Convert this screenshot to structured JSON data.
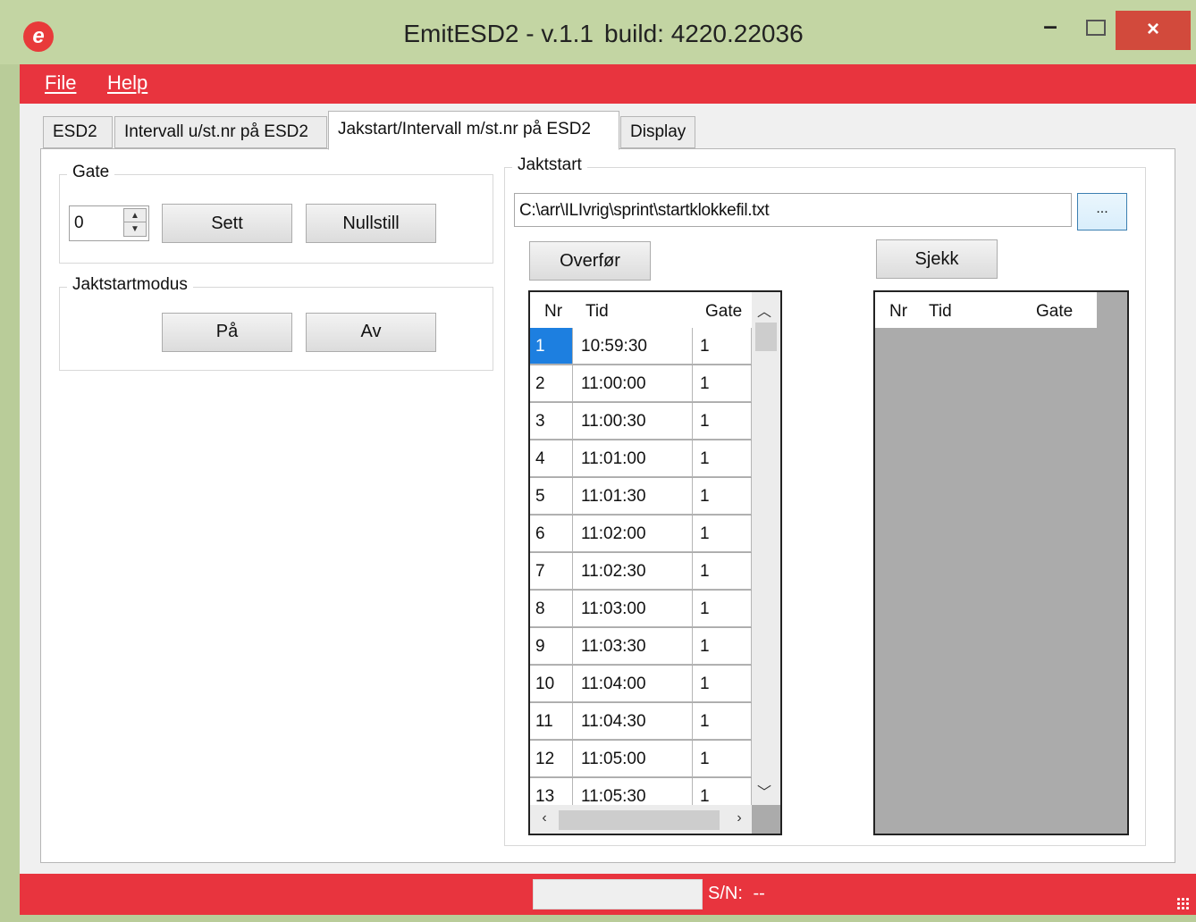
{
  "window": {
    "title": "EmitESD2  - v.1.1",
    "build": "build: 4220.22036",
    "close_glyph": "×",
    "minimize_glyph": "–"
  },
  "menu": {
    "items": [
      "File",
      "Help"
    ]
  },
  "tabs": [
    "ESD2",
    "Intervall u/st.nr på ESD2",
    "Jakstart/Intervall m/st.nr på ESD2",
    "Display"
  ],
  "active_tab": 2,
  "gate_group": {
    "title": "Gate",
    "spinner_value": "0",
    "set_label": "Sett",
    "reset_label": "Nullstill"
  },
  "mode_group": {
    "title": "Jaktstartmodus",
    "on_label": "På",
    "off_label": "Av"
  },
  "jaktstart": {
    "title": "Jaktstart",
    "file_path": "C:\\arr\\ILIvrig\\sprint\\startklokkefil.txt",
    "browse_label": "...",
    "transfer_label": "Overfør",
    "check_label": "Sjekk"
  },
  "left_grid": {
    "columns": [
      "Nr",
      "Tid",
      "Gate"
    ],
    "selected_row": 0,
    "rows": [
      [
        "1",
        "10:59:30",
        "1"
      ],
      [
        "2",
        "11:00:00",
        "1"
      ],
      [
        "3",
        "11:00:30",
        "1"
      ],
      [
        "4",
        "11:01:00",
        "1"
      ],
      [
        "5",
        "11:01:30",
        "1"
      ],
      [
        "6",
        "11:02:00",
        "1"
      ],
      [
        "7",
        "11:02:30",
        "1"
      ],
      [
        "8",
        "11:03:00",
        "1"
      ],
      [
        "9",
        "11:03:30",
        "1"
      ],
      [
        "10",
        "11:04:00",
        "1"
      ],
      [
        "11",
        "11:04:30",
        "1"
      ],
      [
        "12",
        "11:05:00",
        "1"
      ],
      [
        "13",
        "11:05:30",
        "1"
      ]
    ]
  },
  "right_grid": {
    "columns": [
      "Nr",
      "Tid",
      "Gate"
    ],
    "rows": []
  },
  "status": {
    "sn_label": "S/N:",
    "sn_value": "--"
  },
  "colors": {
    "accent_red": "#e8343e",
    "title_green": "#c3d5a3",
    "selection_blue": "#1d7fe0",
    "grid_empty": "#ababab"
  }
}
